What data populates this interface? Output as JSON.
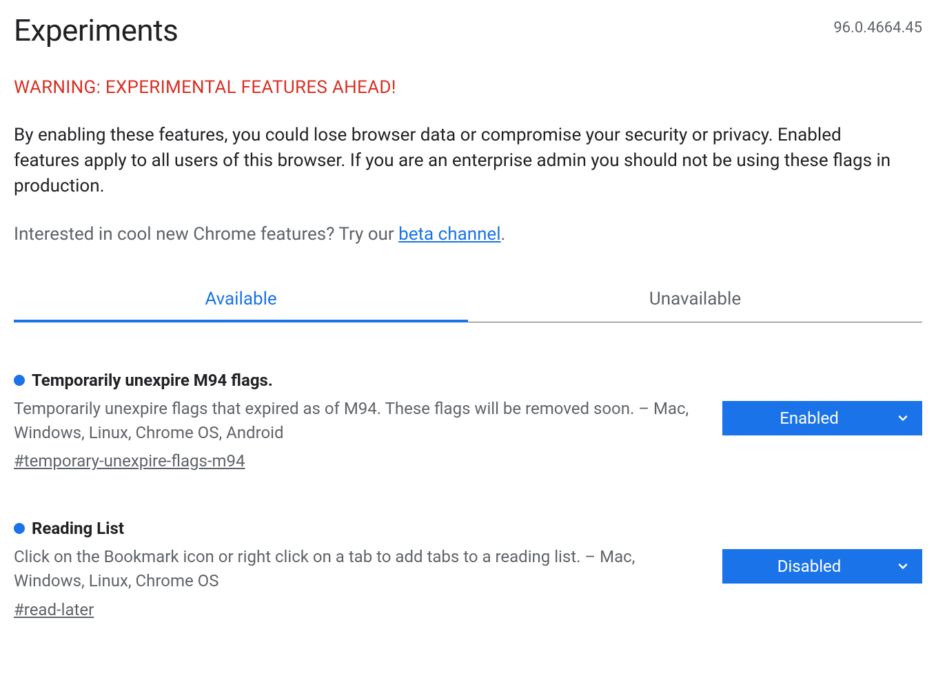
{
  "header": {
    "title": "Experiments",
    "version": "96.0.4664.45"
  },
  "warning": "WARNING: EXPERIMENTAL FEATURES AHEAD!",
  "description": "By enabling these features, you could lose browser data or compromise your security or privacy. Enabled features apply to all users of this browser. If you are an enterprise admin you should not be using these flags in production.",
  "promo": {
    "prefix": "Interested in cool new Chrome features? Try our ",
    "link_text": "beta channel",
    "suffix": "."
  },
  "tabs": {
    "available": "Available",
    "unavailable": "Unavailable"
  },
  "experiments": [
    {
      "title": "Temporarily unexpire M94 flags.",
      "description": "Temporarily unexpire flags that expired as of M94. These flags will be removed soon. – Mac, Windows, Linux, Chrome OS, Android",
      "hash": "#temporary-unexpire-flags-m94",
      "selected": "Enabled"
    },
    {
      "title": "Reading List",
      "description": "Click on the Bookmark icon or right click on a tab to add tabs to a reading list. – Mac, Windows, Linux, Chrome OS",
      "hash": "#read-later",
      "selected": "Disabled"
    }
  ]
}
